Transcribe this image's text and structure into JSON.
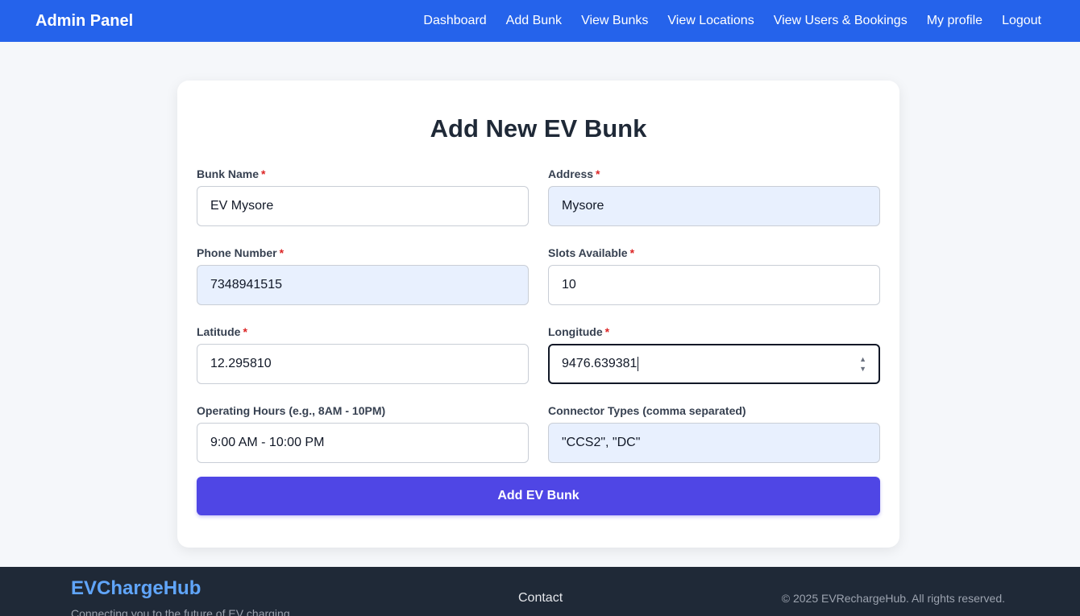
{
  "navbar": {
    "brand": "Admin Panel",
    "links": [
      "Dashboard",
      "Add Bunk",
      "View Bunks",
      "View Locations",
      "View Users & Bookings",
      "My profile",
      "Logout"
    ]
  },
  "form": {
    "title": "Add New EV Bunk",
    "required_marker": "*",
    "fields": {
      "bunk_name": {
        "label": "Bunk Name",
        "value": "EV Mysore"
      },
      "address": {
        "label": "Address",
        "value": "Mysore"
      },
      "phone": {
        "label": "Phone Number",
        "value": "7348941515"
      },
      "slots": {
        "label": "Slots Available",
        "value": "10"
      },
      "latitude": {
        "label": "Latitude",
        "value": "12.295810"
      },
      "longitude": {
        "label": "Longitude",
        "value": "9476.639381"
      },
      "hours": {
        "label": "Operating Hours (e.g., 8AM - 10PM)",
        "value": "9:00 AM - 10:00 PM"
      },
      "connectors": {
        "label": "Connector Types (comma separated)",
        "value": "\"CCS2\", \"DC\""
      }
    },
    "submit_label": "Add EV Bunk"
  },
  "footer": {
    "brand": "EVChargeHub",
    "tagline": "Connecting you to the future of EV charging",
    "contact": "Contact",
    "copyright": "© 2025 EVRechargeHub. All rights reserved."
  },
  "colors": {
    "nav_bg": "#2563eb",
    "button_bg": "#4f46e5",
    "footer_bg": "#1f2937",
    "autofill_bg": "#e8f0fe",
    "required": "#dc2626"
  }
}
